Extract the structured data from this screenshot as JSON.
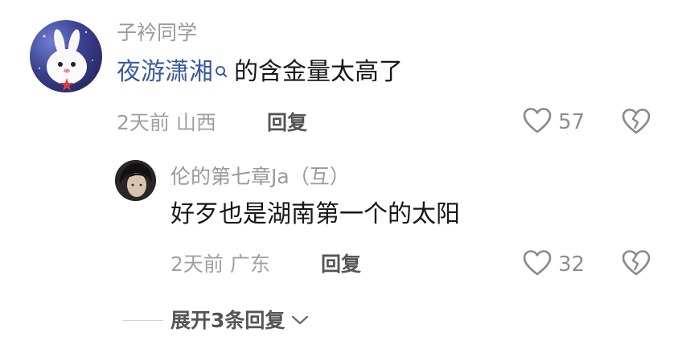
{
  "comment": {
    "username": "子衿同学",
    "mention": "夜游潇湘",
    "text": "的含金量太高了",
    "time": "2天前",
    "location": "山西",
    "reply_label": "回复",
    "like_count": "57"
  },
  "reply": {
    "username": "伦的第七章Ja",
    "relation": "（互）",
    "text": "好歹也是湖南第一个的太阳",
    "time": "2天前",
    "location": "广东",
    "reply_label": "回复",
    "like_count": "32"
  },
  "expand": {
    "label": "展开3条回复"
  },
  "icons": {
    "like": "heart-outline-icon",
    "dislike": "broken-heart-icon",
    "search": "search-icon",
    "chevron": "chevron-down-icon"
  }
}
